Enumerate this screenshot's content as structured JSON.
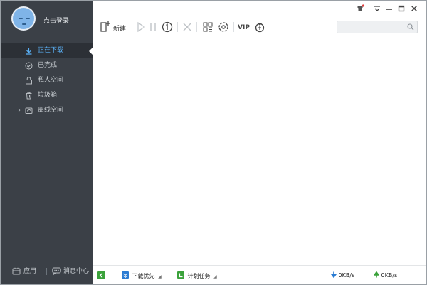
{
  "sidebar": {
    "login_label": "点击登录",
    "items": [
      {
        "label": "正在下载",
        "icon": "download-icon",
        "active": true
      },
      {
        "label": "已完成",
        "icon": "check-circle-icon"
      },
      {
        "label": "私人空间",
        "icon": "lock-icon"
      },
      {
        "label": "垃圾箱",
        "icon": "trash-icon"
      },
      {
        "label": "离线空间",
        "icon": "cloud-folder-icon",
        "expandable": true
      }
    ],
    "apps_label": "应用",
    "messages_label": "消息中心"
  },
  "toolbar": {
    "new_label": "新建",
    "vip_label": "VIP",
    "search_placeholder": ""
  },
  "status": {
    "download_priority_label": "下载优先",
    "scheduled_task_label": "计划任务",
    "download_speed": "0KB/s",
    "upload_speed": "0KB/s"
  },
  "colors": {
    "sidebar_bg": "#3b4047",
    "active_text": "#5ab0f5",
    "accent_green": "#3ba23b",
    "accent_blue": "#2b7cd3"
  }
}
